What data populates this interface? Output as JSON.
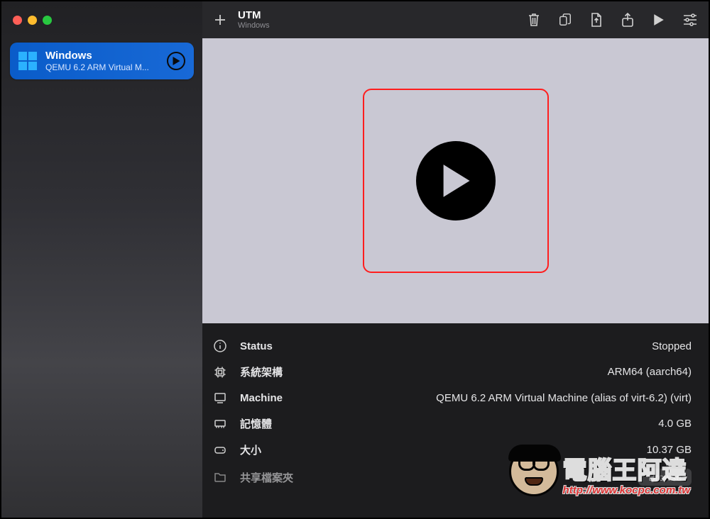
{
  "app": {
    "title": "UTM",
    "subtitle": "Windows"
  },
  "sidebar": {
    "vm": {
      "name": "Windows",
      "subtitle": "QEMU 6.2 ARM Virtual M..."
    }
  },
  "details": {
    "status": {
      "label": "Status",
      "value": "Stopped"
    },
    "arch": {
      "label": "系統架構",
      "value": "ARM64 (aarch64)"
    },
    "machine": {
      "label": "Machine",
      "value": "QEMU 6.2 ARM Virtual Machine (alias of virt-6.2) (virt)"
    },
    "memory": {
      "label": "記憶體",
      "value": "4.0 GB"
    },
    "size": {
      "label": "大小",
      "value": "10.37 GB"
    },
    "shared": {
      "label": "共享檔案夾",
      "button": "Browse"
    }
  },
  "watermark": {
    "big": "電腦王阿達",
    "url": "http://www.kocpc.com.tw"
  }
}
